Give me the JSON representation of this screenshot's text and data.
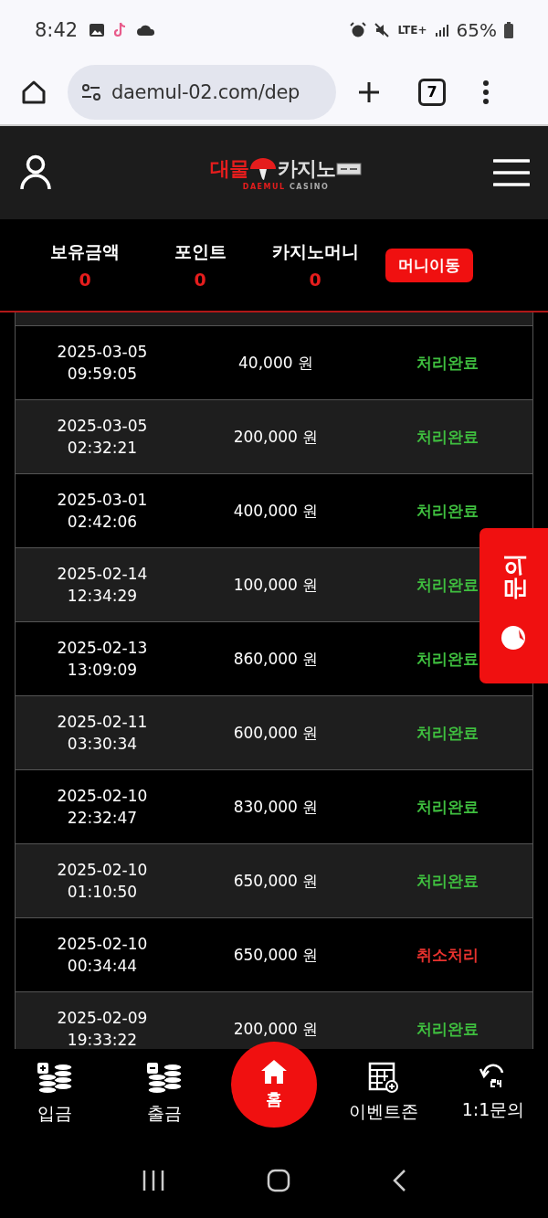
{
  "status_bar": {
    "time": "8:42",
    "network": "LTE+",
    "battery": "65%"
  },
  "browser": {
    "url": "daemul-02.com/dep",
    "tab_count": "7"
  },
  "header": {
    "logo": {
      "red": "대물",
      "white": "카지노",
      "sub_red": "DAEMUL",
      "sub_grey": "CASINO"
    }
  },
  "balances": [
    {
      "label": "보유금액",
      "value": "0"
    },
    {
      "label": "포인트",
      "value": "0"
    },
    {
      "label": "카지노머니",
      "value": "0"
    }
  ],
  "move_money_button": "머니이동",
  "rows": [
    {
      "date": "2025-03-05",
      "time": "09:59:05",
      "amount": "40,000 원",
      "status": "처리완료",
      "kind": "done"
    },
    {
      "date": "2025-03-05",
      "time": "02:32:21",
      "amount": "200,000 원",
      "status": "처리완료",
      "kind": "done"
    },
    {
      "date": "2025-03-01",
      "time": "02:42:06",
      "amount": "400,000 원",
      "status": "처리완료",
      "kind": "done"
    },
    {
      "date": "2025-02-14",
      "time": "12:34:29",
      "amount": "100,000 원",
      "status": "처리완료",
      "kind": "done"
    },
    {
      "date": "2025-02-13",
      "time": "13:09:09",
      "amount": "860,000 원",
      "status": "처리완료",
      "kind": "done"
    },
    {
      "date": "2025-02-11",
      "time": "03:30:34",
      "amount": "600,000 원",
      "status": "처리완료",
      "kind": "done"
    },
    {
      "date": "2025-02-10",
      "time": "22:32:47",
      "amount": "830,000 원",
      "status": "처리완료",
      "kind": "done"
    },
    {
      "date": "2025-02-10",
      "time": "01:10:50",
      "amount": "650,000 원",
      "status": "처리완료",
      "kind": "done"
    },
    {
      "date": "2025-02-10",
      "time": "00:34:44",
      "amount": "650,000 원",
      "status": "취소처리",
      "kind": "cancelled"
    },
    {
      "date": "2025-02-09",
      "time": "19:33:22",
      "amount": "200,000 원",
      "status": "처리완료",
      "kind": "done"
    }
  ],
  "side_tab": {
    "label": "문의"
  },
  "bottom_nav": [
    {
      "label": "입금",
      "kind": "deposit"
    },
    {
      "label": "출금",
      "kind": "withdraw"
    },
    {
      "label": "홈",
      "kind": "home"
    },
    {
      "label": "이벤트존",
      "kind": "event"
    },
    {
      "label": "1:1문의",
      "kind": "support"
    }
  ]
}
